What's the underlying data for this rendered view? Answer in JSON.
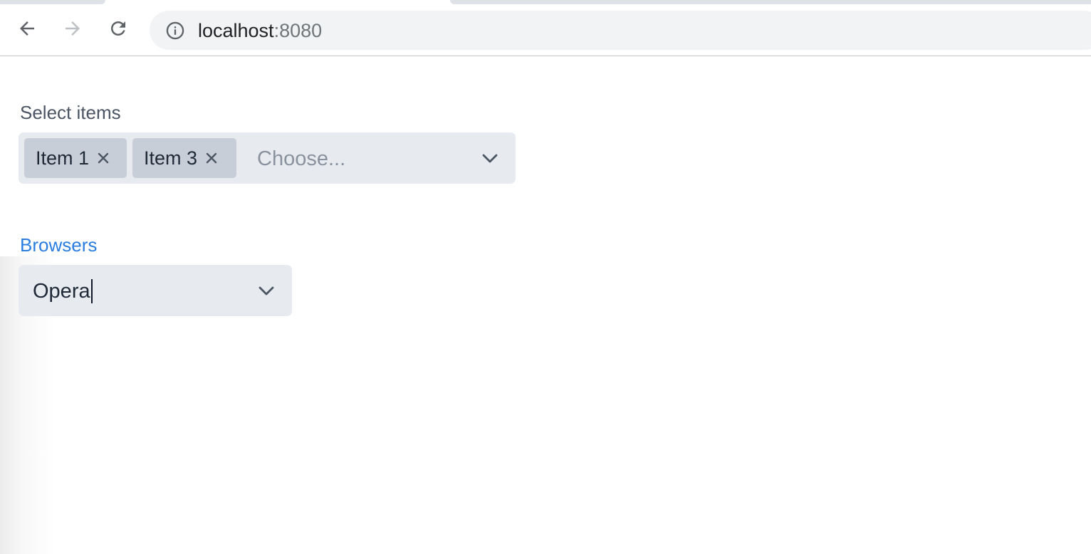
{
  "browser": {
    "url_host": "localhost",
    "url_port": ":8080",
    "back_icon": "back-arrow-icon",
    "forward_icon": "forward-arrow-icon",
    "reload_icon": "reload-icon",
    "site_info_icon": "info-icon"
  },
  "multiselect": {
    "label": "Select items",
    "selected": [
      {
        "label": "Item 1"
      },
      {
        "label": "Item 3"
      }
    ],
    "remove_icon": "close-icon",
    "placeholder": "Choose...",
    "dropdown_icon": "chevron-down-icon"
  },
  "browsers_select": {
    "label": "Browsers",
    "value": "Opera",
    "dropdown_icon": "chevron-down-icon",
    "label_color": "#2b7de0"
  }
}
